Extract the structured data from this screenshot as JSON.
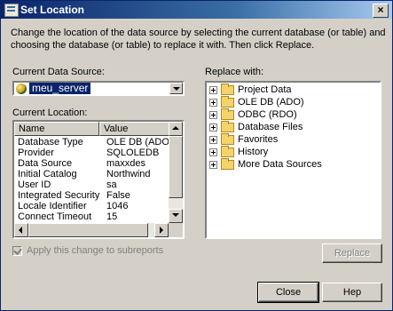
{
  "window": {
    "title": "Set Location",
    "close_glyph": "×"
  },
  "description": "Change the location of the data source by selecting the current database (or table) and choosing the database (or table) to replace it with.  Then click Replace.",
  "current_data_source": {
    "label": "Current Data Source:",
    "value": "meu_server",
    "icon": "database-icon"
  },
  "current_location": {
    "label": "Current Location:",
    "columns": [
      "Name",
      "Value"
    ],
    "rows": [
      {
        "name": "Database Type",
        "value": "OLE DB (ADO)"
      },
      {
        "name": "Provider",
        "value": "SQLOLEDB"
      },
      {
        "name": "Data Source",
        "value": "maxxdes"
      },
      {
        "name": "Initial Catalog",
        "value": "Northwind"
      },
      {
        "name": "User ID",
        "value": "sa"
      },
      {
        "name": "Integrated Security",
        "value": "False"
      },
      {
        "name": "Locale Identifier",
        "value": "1046"
      },
      {
        "name": "Connect Timeout",
        "value": "15"
      }
    ]
  },
  "apply_subreports": {
    "label": "Apply this change to subreports",
    "checked": true,
    "enabled": false
  },
  "replace_with": {
    "label": "Replace with:",
    "items": [
      {
        "label": "Project Data",
        "icon": "folder-icon"
      },
      {
        "label": "OLE DB (ADO)",
        "icon": "folder-icon"
      },
      {
        "label": "ODBC (RDO)",
        "icon": "folder-icon"
      },
      {
        "label": "Database Files",
        "icon": "folder-icon"
      },
      {
        "label": "Favorites",
        "icon": "folder-icon"
      },
      {
        "label": "History",
        "icon": "folder-icon"
      },
      {
        "label": "More Data Sources",
        "icon": "folder-icon"
      }
    ]
  },
  "buttons": {
    "replace": "Replace",
    "close": "Close",
    "help": "Hep"
  },
  "colors": {
    "title_start": "#0a246a",
    "title_end": "#a6caf0",
    "dialog_bg": "#d4d0c8",
    "selection": "#0a246a",
    "folder": "#f5d36b"
  }
}
